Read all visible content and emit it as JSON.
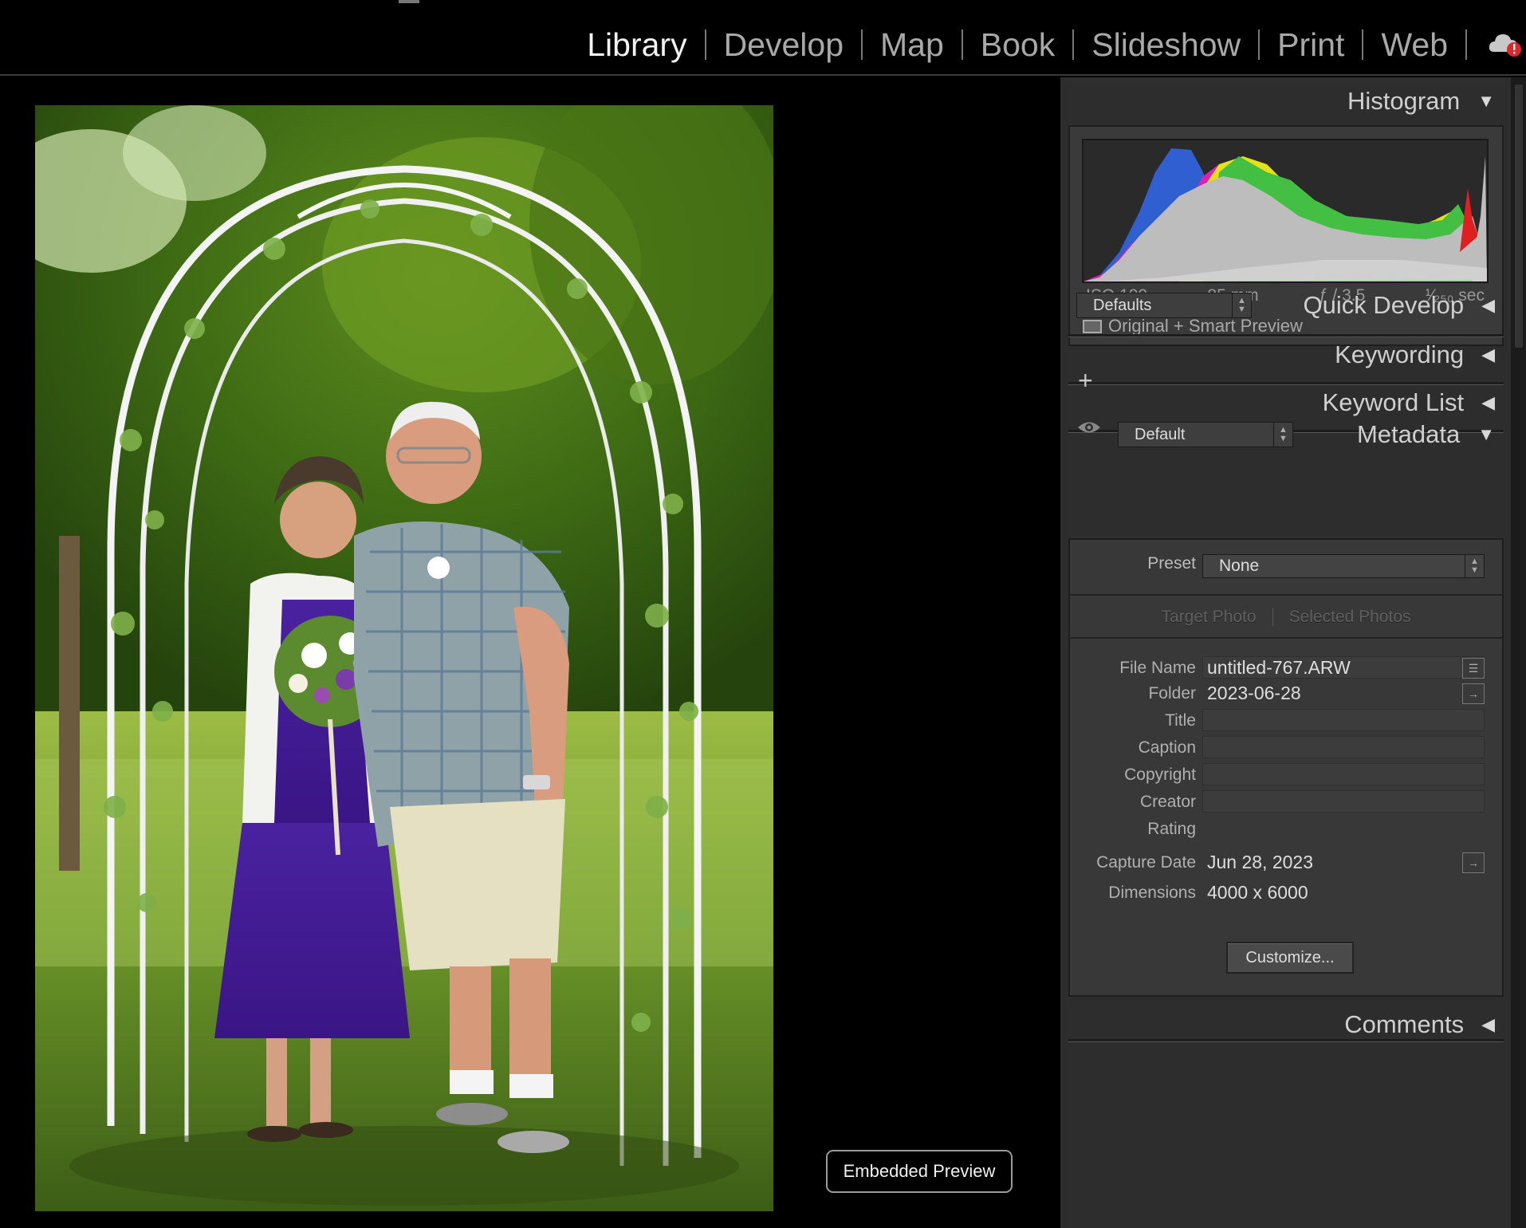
{
  "modules": [
    "Library",
    "Develop",
    "Map",
    "Book",
    "Slideshow",
    "Print",
    "Web"
  ],
  "active_module": "Library",
  "icons": {
    "cloud": "cloud-sync-error-icon",
    "eye": "eye-icon",
    "plus": "plus-icon",
    "list": "list-icon",
    "goto": "arrow-right-icon"
  },
  "main": {
    "embedded_preview": "Embedded Preview"
  },
  "histogram": {
    "title": "Histogram",
    "iso": "ISO 100",
    "focal": "85 mm",
    "aperture": "ƒ / 3.5",
    "shutter": "¹⁄₂₅₀ sec",
    "preview_status": "Original + Smart Preview"
  },
  "quick_develop": {
    "title": "Quick Develop",
    "preset": "Defaults"
  },
  "keywording": {
    "title": "Keywording"
  },
  "keyword_list": {
    "title": "Keyword List",
    "add": "+"
  },
  "metadata": {
    "title": "Metadata",
    "view": "Default",
    "preset_label": "Preset",
    "preset_value": "None",
    "target_photo": "Target Photo",
    "selected_photos": "Selected Photos",
    "fields": {
      "file_name": {
        "label": "File Name",
        "value": "untitled-767.ARW"
      },
      "folder": {
        "label": "Folder",
        "value": "2023-06-28"
      },
      "title": {
        "label": "Title",
        "value": ""
      },
      "caption": {
        "label": "Caption",
        "value": ""
      },
      "copyright": {
        "label": "Copyright",
        "value": ""
      },
      "creator": {
        "label": "Creator",
        "value": ""
      },
      "rating": {
        "label": "Rating",
        "value": ""
      },
      "capture_date": {
        "label": "Capture Date",
        "value": "Jun 28, 2023"
      },
      "dimensions": {
        "label": "Dimensions",
        "value": "4000 x 6000"
      }
    },
    "customize": "Customize..."
  },
  "comments": {
    "title": "Comments"
  },
  "colors": {
    "accent_active": "#f2f2f2",
    "panel_bg": "#2d2d2d",
    "alert": "#e0262d"
  }
}
